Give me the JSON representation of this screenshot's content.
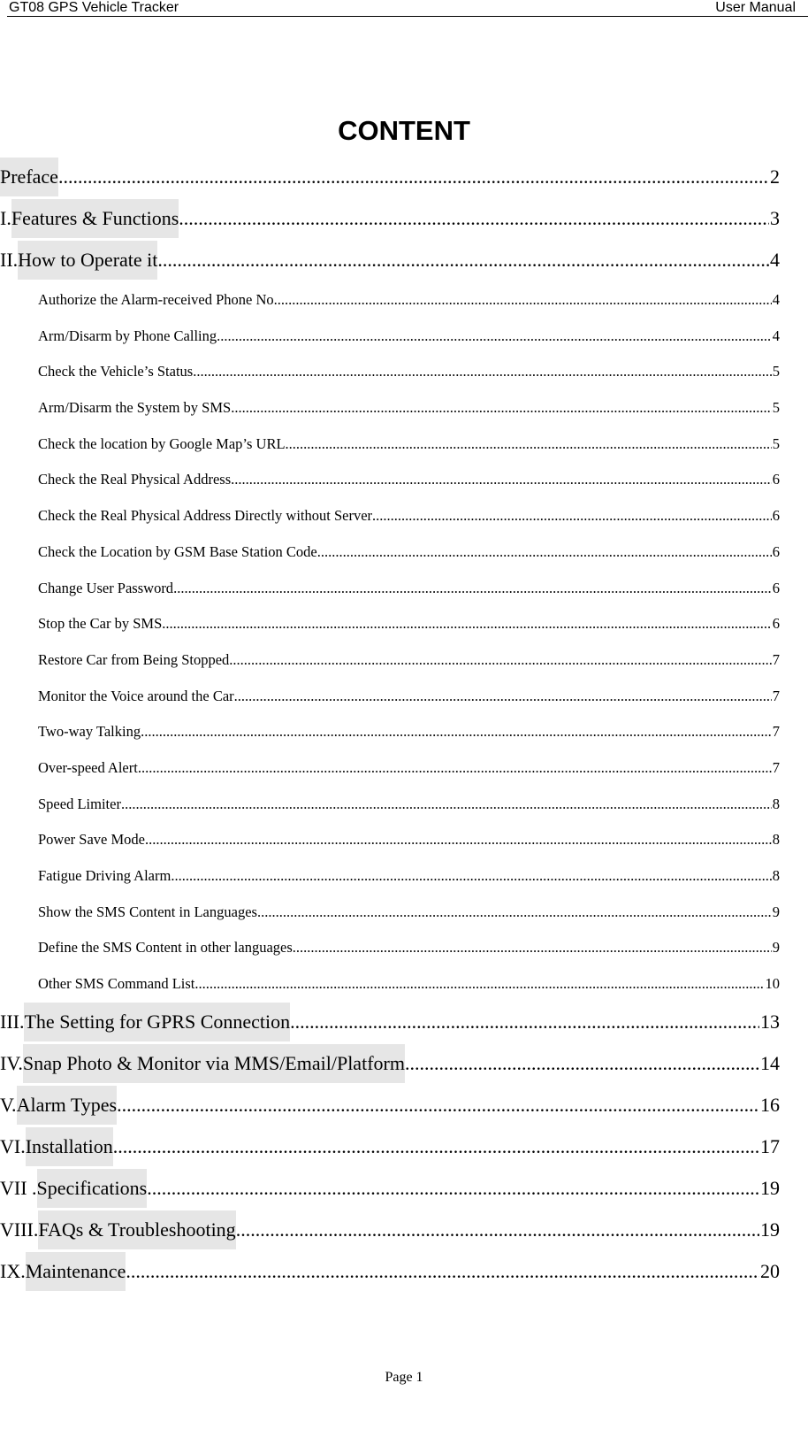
{
  "header": {
    "left": "GT08 GPS Vehicle Tracker",
    "right": "User Manual"
  },
  "title": "CONTENT",
  "toc": [
    {
      "level": "main",
      "prefix": "",
      "title": "Preface",
      "page": "2"
    },
    {
      "level": "main",
      "prefix": "I. ",
      "title": "Features & Functions",
      "page": "3"
    },
    {
      "level": "main",
      "prefix": "II. ",
      "title": "How to Operate it",
      "page": "4"
    },
    {
      "level": "sub",
      "prefix": "",
      "title": "Authorize the Alarm-received Phone No",
      "page": "4"
    },
    {
      "level": "sub",
      "prefix": "",
      "title": "Arm/Disarm by Phone Calling",
      "page": "4"
    },
    {
      "level": "sub",
      "prefix": "",
      "title": "Check the Vehicle’s Status",
      "page": "5"
    },
    {
      "level": "sub",
      "prefix": "",
      "title": "Arm/Disarm the System by SMS",
      "page": "5"
    },
    {
      "level": "sub",
      "prefix": "",
      "title": "Check the location by Google Map’s URL",
      "page": "5"
    },
    {
      "level": "sub",
      "prefix": "",
      "title": "Check the Real Physical Address",
      "page": "6"
    },
    {
      "level": "sub",
      "prefix": "",
      "title": "Check the Real Physical Address Directly without Server",
      "page": "6"
    },
    {
      "level": "sub",
      "prefix": "",
      "title": "Check the Location by GSM Base Station Code",
      "page": "6"
    },
    {
      "level": "sub",
      "prefix": "",
      "title": "Change User Password",
      "page": "6"
    },
    {
      "level": "sub",
      "prefix": "",
      "title": "Stop the Car by SMS",
      "page": "6"
    },
    {
      "level": "sub",
      "prefix": "",
      "title": "Restore Car from Being Stopped",
      "page": "7"
    },
    {
      "level": "sub",
      "prefix": "",
      "title": "Monitor the Voice around the Car",
      "page": "7"
    },
    {
      "level": "sub",
      "prefix": "",
      "title": "Two-way Talking",
      "page": "7"
    },
    {
      "level": "sub",
      "prefix": "",
      "title": "Over-speed Alert",
      "page": "7"
    },
    {
      "level": "sub",
      "prefix": "",
      "title": "Speed Limiter",
      "page": "8"
    },
    {
      "level": "sub",
      "prefix": "",
      "title": "Power Save Mode",
      "page": "8"
    },
    {
      "level": "sub",
      "prefix": "",
      "title": "Fatigue Driving Alarm",
      "page": "8"
    },
    {
      "level": "sub",
      "prefix": "",
      "title": "Show the SMS Content in Languages",
      "page": "9"
    },
    {
      "level": "sub",
      "prefix": "",
      "title": "Define the SMS Content in other languages",
      "page": "9"
    },
    {
      "level": "sub",
      "prefix": "",
      "title": "Other SMS Command List",
      "page": "10"
    },
    {
      "level": "main",
      "prefix": "III. ",
      "title": "The Setting for GPRS Connection",
      "page": "13"
    },
    {
      "level": "main",
      "prefix": "IV. ",
      "title": "Snap Photo & Monitor via MMS/Email/Platform",
      "page": "14"
    },
    {
      "level": "main",
      "prefix": "V. ",
      "title": "Alarm Types",
      "page": "16"
    },
    {
      "level": "main",
      "prefix": "VI. ",
      "title": "Installation",
      "page": "17"
    },
    {
      "level": "main",
      "prefix": "VII . ",
      "title": "Specifications",
      "page": "19"
    },
    {
      "level": "main",
      "prefix": "VIII. ",
      "title": "FAQs & Troubleshooting",
      "page": "19"
    },
    {
      "level": "main",
      "prefix": "IX. ",
      "title": "Maintenance",
      "page": "20"
    }
  ],
  "footer": "Page 1"
}
